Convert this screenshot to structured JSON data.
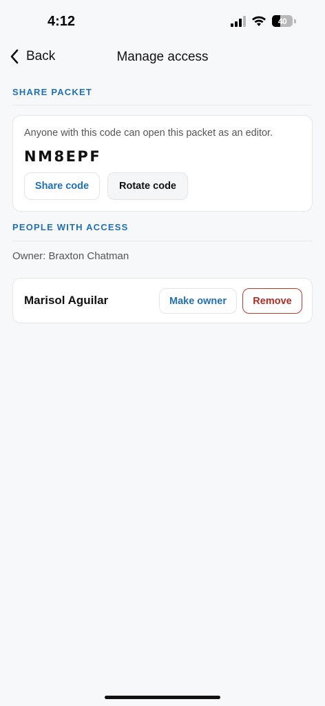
{
  "status_bar": {
    "time": "4:12",
    "battery": "40"
  },
  "nav": {
    "back_label": "Back",
    "title": "Manage access"
  },
  "share_section": {
    "header": "SHARE PACKET",
    "description": "Anyone with this code can open this packet as an editor.",
    "code": "NM8EPF",
    "share_button": "Share code",
    "rotate_button": "Rotate code"
  },
  "people_section": {
    "header": "PEOPLE WITH ACCESS",
    "owner_text": "Owner: Braxton Chatman",
    "members": [
      {
        "name": "Marisol Aguilar",
        "make_owner_label": "Make owner",
        "remove_label": "Remove"
      }
    ]
  },
  "colors": {
    "accent": "#1f6fb5",
    "danger": "#c0392b",
    "background": "#f7f8fa"
  }
}
